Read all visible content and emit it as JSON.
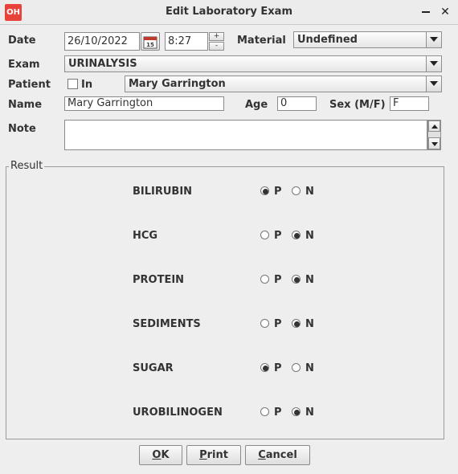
{
  "window": {
    "app_logo": "OH",
    "title": "Edit Laboratory Exam",
    "minimize_icon": "minimize-icon",
    "close_icon": "close-icon"
  },
  "form": {
    "date_label": "Date",
    "date_value": "26/10/2022",
    "calendar_icon_text": "15",
    "time_value": "8:27",
    "spin_up": "+",
    "spin_down": "-",
    "material_label": "Material",
    "material_value": "Undefined",
    "exam_label": "Exam",
    "exam_value": "URINALYSIS",
    "patient_label": "Patient",
    "in_label": "In",
    "in_checked": false,
    "patient_value": "Mary Garrington",
    "name_label": "Name",
    "name_value": "Mary Garrington",
    "age_label": "Age",
    "age_value": "0",
    "sex_label": "Sex (M/F)",
    "sex_value": "F",
    "note_label": "Note",
    "note_value": ""
  },
  "result": {
    "legend": "Result",
    "p_label": "P",
    "n_label": "N",
    "rows": [
      {
        "name": "BILIRUBIN",
        "selected": "P"
      },
      {
        "name": "HCG",
        "selected": "N"
      },
      {
        "name": "PROTEIN",
        "selected": "N"
      },
      {
        "name": "SEDIMENTS",
        "selected": "N"
      },
      {
        "name": "SUGAR",
        "selected": "P"
      },
      {
        "name": "UROBILINOGEN",
        "selected": "N"
      }
    ]
  },
  "buttons": {
    "ok_mnemonic": "O",
    "ok_rest": "K",
    "print_mnemonic": "P",
    "print_rest": "rint",
    "cancel_mnemonic": "C",
    "cancel_rest": "ancel"
  }
}
